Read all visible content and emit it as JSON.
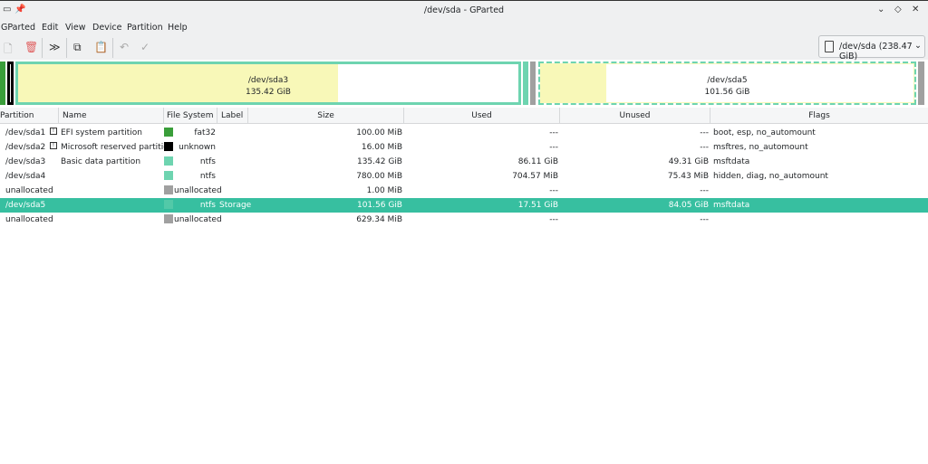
{
  "window": {
    "title": "/dev/sda - GParted"
  },
  "menu": [
    "GParted",
    "Edit",
    "View",
    "Device",
    "Partition",
    "Help"
  ],
  "device_selector": "/dev/sda (238.47 GiB)",
  "disk_map": {
    "sda3": {
      "name": "/dev/sda3",
      "size": "135.42 GiB",
      "used_fraction": 0.64
    },
    "sda5": {
      "name": "/dev/sda5",
      "size": "101.56 GiB",
      "used_fraction": 0.17
    }
  },
  "columns": [
    "Partition",
    "Name",
    "File System",
    "Label",
    "Size",
    "Used",
    "Unused",
    "Flags"
  ],
  "rows": [
    {
      "partition": "/dev/sda1",
      "name": "EFI system partition",
      "info": true,
      "fs": "fat32",
      "color": "#3a9e3a",
      "label": "",
      "size": "100.00 MiB",
      "used": "---",
      "unused": "---",
      "flags": "boot, esp, no_automount"
    },
    {
      "partition": "/dev/sda2",
      "name": "Microsoft reserved partition",
      "info": true,
      "fs": "unknown",
      "color": "#000000",
      "label": "",
      "size": "16.00 MiB",
      "used": "---",
      "unused": "---",
      "flags": "msftres, no_automount"
    },
    {
      "partition": "/dev/sda3",
      "name": "Basic data partition",
      "info": false,
      "fs": "ntfs",
      "color": "#6ed4b0",
      "label": "",
      "size": "135.42 GiB",
      "used": "86.11 GiB",
      "unused": "49.31 GiB",
      "flags": "msftdata"
    },
    {
      "partition": "/dev/sda4",
      "name": "",
      "info": false,
      "fs": "ntfs",
      "color": "#6ed4b0",
      "label": "",
      "size": "780.00 MiB",
      "used": "704.57 MiB",
      "unused": "75.43 MiB",
      "flags": "hidden, diag, no_automount"
    },
    {
      "partition": "unallocated",
      "name": "",
      "info": false,
      "fs": "unallocated",
      "color": "#a0a0a0",
      "label": "",
      "size": "1.00 MiB",
      "used": "---",
      "unused": "---",
      "flags": ""
    },
    {
      "partition": "/dev/sda5",
      "name": "",
      "info": false,
      "fs": "ntfs",
      "color": "#6ed4b0",
      "label": "Storage",
      "size": "101.56 GiB",
      "used": "17.51 GiB",
      "unused": "84.05 GiB",
      "flags": "msftdata",
      "selected": true
    },
    {
      "partition": "unallocated",
      "name": "",
      "info": false,
      "fs": "unallocated",
      "color": "#a0a0a0",
      "label": "",
      "size": "629.34 MiB",
      "used": "---",
      "unused": "---",
      "flags": ""
    }
  ]
}
